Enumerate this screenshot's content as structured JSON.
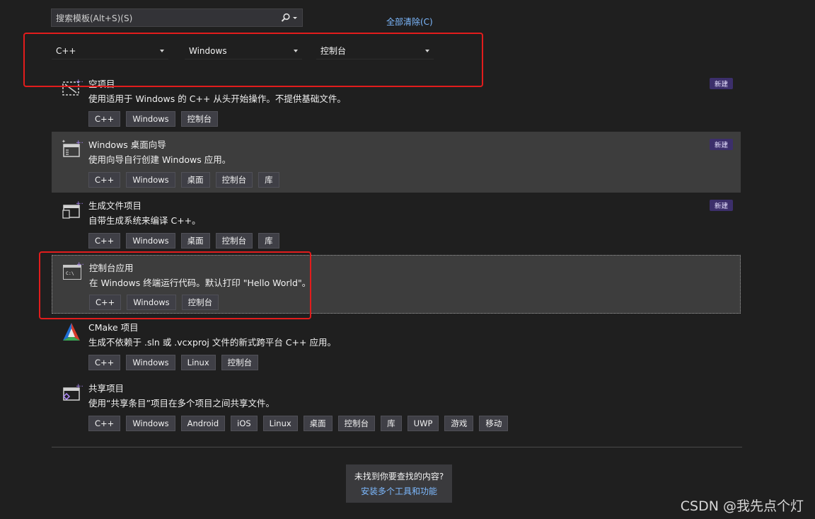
{
  "search": {
    "placeholder": "搜索模板(Alt+S)(S)"
  },
  "clear_all": "全部清除(C)",
  "filters": {
    "language": "C++",
    "platform": "Windows",
    "project_type": "控制台"
  },
  "templates": [
    {
      "title": "空项目",
      "description": "使用适用于 Windows 的 C++ 从头开始操作。不提供基础文件。",
      "tags": [
        "C++",
        "Windows",
        "控制台"
      ],
      "badge": "新建",
      "icon": "empty-project-icon"
    },
    {
      "title": "Windows 桌面向导",
      "description": "使用向导自行创建 Windows 应用。",
      "tags": [
        "C++",
        "Windows",
        "桌面",
        "控制台",
        "库"
      ],
      "badge": "新建",
      "icon": "desktop-wizard-icon"
    },
    {
      "title": "生成文件项目",
      "description": "自带生成系统来编译 C++。",
      "tags": [
        "C++",
        "Windows",
        "桌面",
        "控制台",
        "库"
      ],
      "badge": "新建",
      "icon": "makefile-project-icon"
    },
    {
      "title": "控制台应用",
      "description": "在 Windows 终端运行代码。默认打印 \"Hello World\"。",
      "tags": [
        "C++",
        "Windows",
        "控制台"
      ],
      "icon": "console-app-icon",
      "icon_text": "C:\\"
    },
    {
      "title": "CMake 项目",
      "description": "生成不依赖于 .sln 或 .vcxproj 文件的新式跨平台 C++ 应用。",
      "tags": [
        "C++",
        "Windows",
        "Linux",
        "控制台"
      ],
      "icon": "cmake-icon"
    },
    {
      "title": "共享项目",
      "description": "使用“共享条目”项目在多个项目之间共享文件。",
      "tags": [
        "C++",
        "Windows",
        "Android",
        "iOS",
        "Linux",
        "桌面",
        "控制台",
        "库",
        "UWP",
        "游戏",
        "移动"
      ],
      "icon": "shared-project-icon"
    }
  ],
  "not_found": {
    "question": "未找到你要查找的内容?",
    "link": "安装多个工具和功能"
  },
  "watermark": "CSDN @我先点个灯",
  "colors": {
    "background": "#1f1f1f",
    "highlight": "#e21c1c",
    "link": "#7db9ff",
    "badge": "#3c2f6b"
  }
}
